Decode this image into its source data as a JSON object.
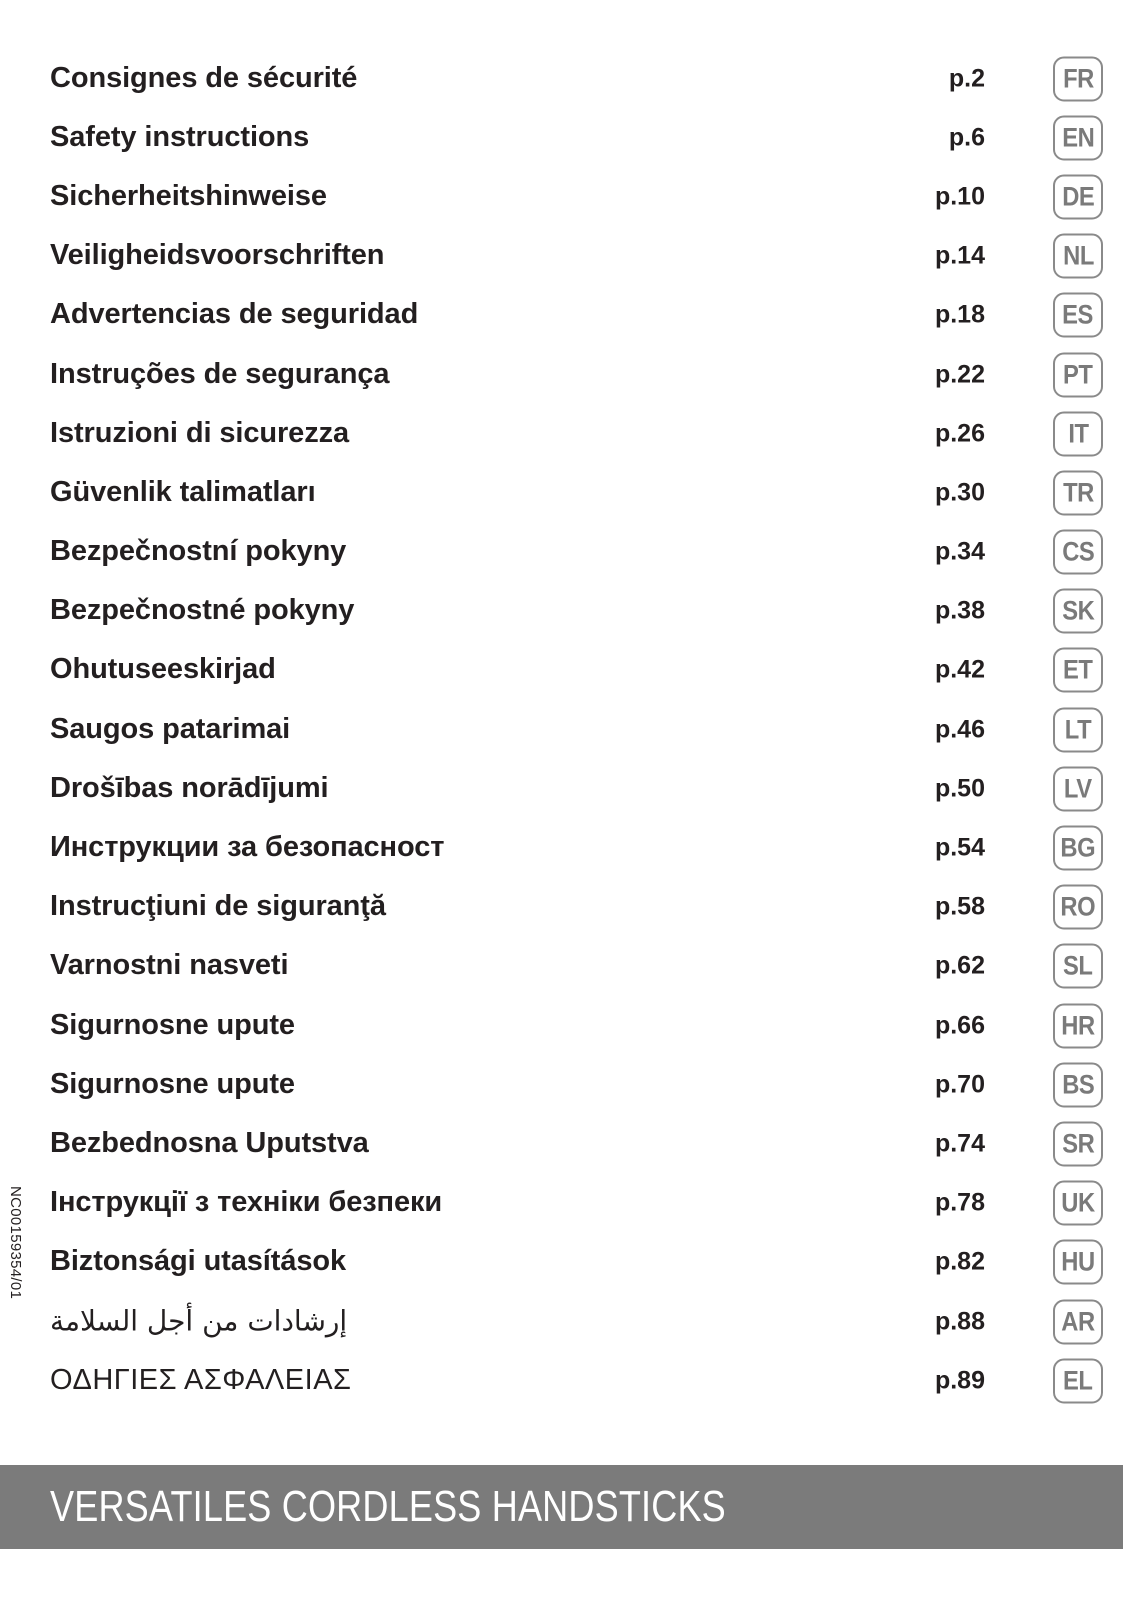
{
  "document": {
    "reference_code": "NC00159354/01"
  },
  "index": {
    "rows": [
      {
        "title": "Consignes de sécurité",
        "page": "p.2",
        "code": "FR",
        "script": "latin"
      },
      {
        "title": "Safety instructions",
        "page": "p.6",
        "code": "EN",
        "script": "latin"
      },
      {
        "title": "Sicherheitshinweise",
        "page": "p.10",
        "code": "DE",
        "script": "latin"
      },
      {
        "title": "Veiligheidsvoorschriften",
        "page": "p.14",
        "code": "NL",
        "script": "latin"
      },
      {
        "title": "Advertencias de seguridad",
        "page": "p.18",
        "code": "ES",
        "script": "latin"
      },
      {
        "title": "Instruções de segurança",
        "page": "p.22",
        "code": "PT",
        "script": "latin"
      },
      {
        "title": "Istruzioni di sicurezza",
        "page": "p.26",
        "code": "IT",
        "script": "latin"
      },
      {
        "title": "Güvenlik talimatları",
        "page": "p.30",
        "code": "TR",
        "script": "latin"
      },
      {
        "title": "Bezpečnostní pokyny",
        "page": "p.34",
        "code": "CS",
        "script": "latin"
      },
      {
        "title": "Bezpečnostné pokyny",
        "page": "p.38",
        "code": "SK",
        "script": "latin"
      },
      {
        "title": "Ohutuseeskirjad",
        "page": "p.42",
        "code": "ET",
        "script": "latin"
      },
      {
        "title": "Saugos patarimai",
        "page": "p.46",
        "code": "LT",
        "script": "latin"
      },
      {
        "title": "Drošības norādījumi",
        "page": "p.50",
        "code": "LV",
        "script": "latin"
      },
      {
        "title": "Инструкции за безопасност",
        "page": "p.54",
        "code": "BG",
        "script": "cyrillic"
      },
      {
        "title": "Instrucţiuni de siguranţă",
        "page": "p.58",
        "code": "RO",
        "script": "latin"
      },
      {
        "title": "Varnostni nasveti",
        "page": "p.62",
        "code": "SL",
        "script": "latin"
      },
      {
        "title": "Sigurnosne upute",
        "page": "p.66",
        "code": "HR",
        "script": "latin"
      },
      {
        "title": "Sigurnosne upute",
        "page": "p.70",
        "code": "BS",
        "script": "latin"
      },
      {
        "title": "Bezbednosna Uputstva",
        "page": "p.74",
        "code": "SR",
        "script": "latin"
      },
      {
        "title": "Інструкції з техніки безпеки",
        "page": "p.78",
        "code": "UK",
        "script": "cyrillic"
      },
      {
        "title": "Biztonsági utasítások",
        "page": "p.82",
        "code": "HU",
        "script": "latin"
      },
      {
        "title": "إرشادات من أجل السلامة",
        "page": "p.88",
        "code": "AR",
        "script": "arabic"
      },
      {
        "title": "ΟΔΗΓΙΕΣ ΑΣΦΑΛΕΙΑΣ",
        "page": "p.89",
        "code": "EL",
        "script": "greek"
      }
    ]
  },
  "banner": {
    "title": "VERSATILES CORDLESS HANDSTICKS",
    "background_color": "#7b7b7b",
    "text_color": "#ffffff"
  },
  "colors": {
    "text": "#231f20",
    "badge_border": "#8a8a8a",
    "badge_text": "#7a7a7a",
    "page_background": "#ffffff"
  }
}
